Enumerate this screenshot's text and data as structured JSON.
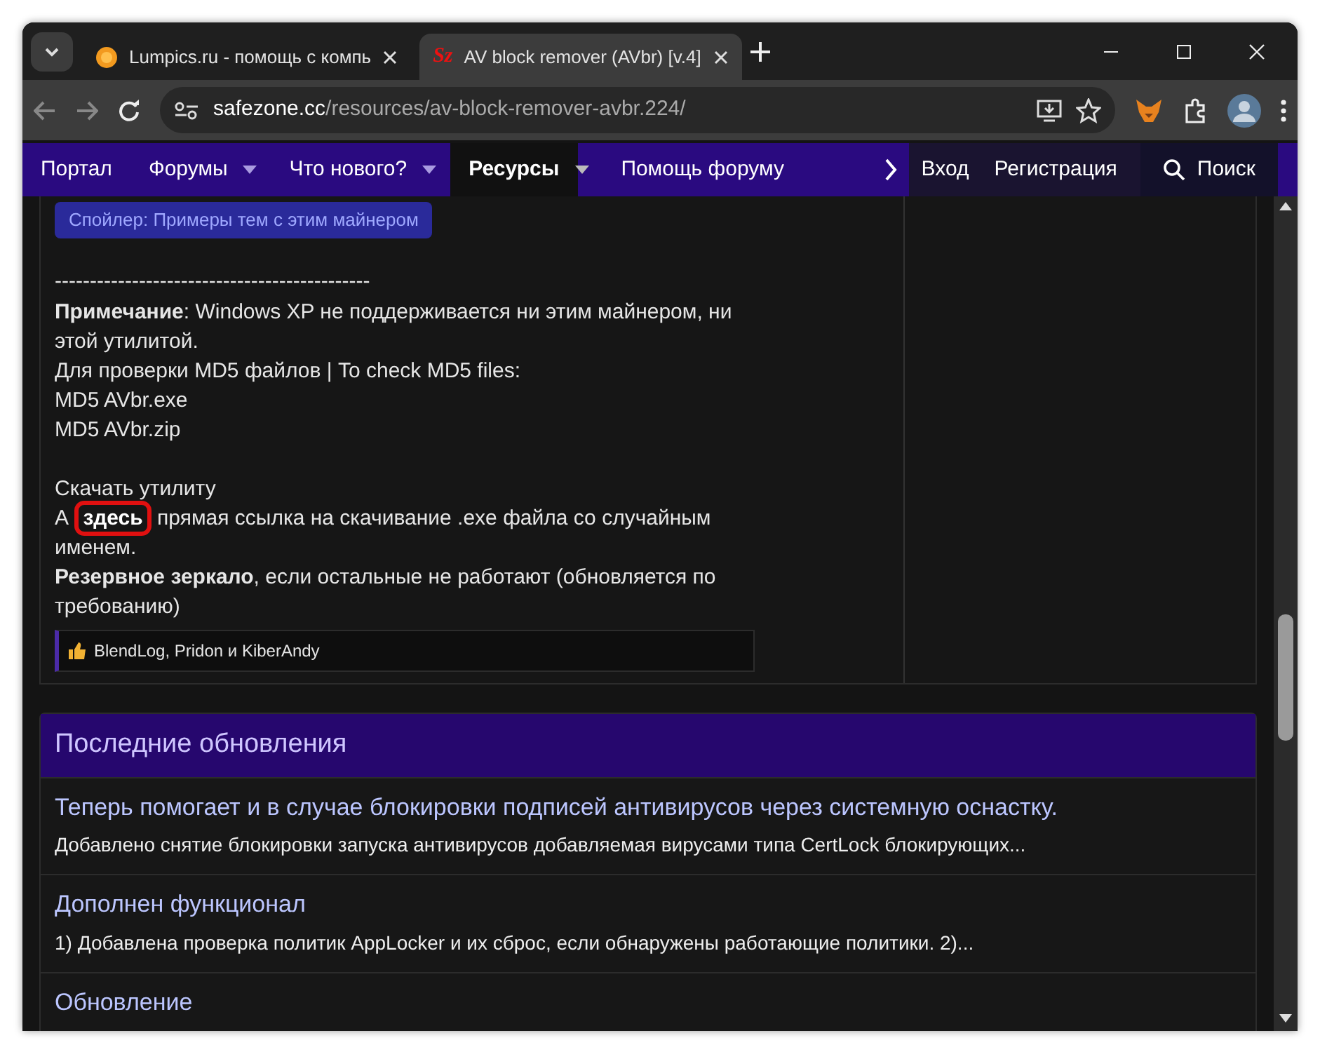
{
  "browser": {
    "tabs": [
      {
        "title": "Lumpics.ru - помощь с компь",
        "selected": false
      },
      {
        "title": "AV block remover (AVbr) [v.4]",
        "selected": true,
        "icon_text": "Sz"
      }
    ],
    "address": {
      "domain": "safezone.cc",
      "path": "/resources/av-block-remover-avbr.224/"
    }
  },
  "nav": {
    "items": [
      {
        "label": "Портал",
        "dropdown": false,
        "selected": false
      },
      {
        "label": "Форумы",
        "dropdown": true,
        "selected": false
      },
      {
        "label": "Что нового?",
        "dropdown": true,
        "selected": false
      },
      {
        "label": "Ресурсы",
        "dropdown": true,
        "selected": true
      },
      {
        "label": "Помощь форуму",
        "dropdown": false,
        "selected": false
      }
    ],
    "account": [
      "Вход",
      "Регистрация"
    ],
    "search": "Поиск"
  },
  "post": {
    "spoiler": "Спойлер: Примеры тем с этим майнером",
    "divider": "---------------------------------------------",
    "lines": [
      {
        "kind": "text",
        "text": "**Примечание**: Windows XP не поддерживается ни этим майнером, ни этой утилитой."
      },
      {
        "kind": "text",
        "text": "Для проверки MD5 файлов | To check MD5 files:"
      },
      {
        "kind": "text",
        "text": "MD5 AVbr.exe"
      },
      {
        "kind": "text",
        "text": "MD5 AVbr.zip"
      },
      {
        "kind": "blank"
      },
      {
        "kind": "text",
        "text": "Скачать утилиту"
      },
      {
        "kind": "link",
        "before": "А ",
        "link": "здесь",
        "after": " прямая ссылка на скачивание .exe файла со случайным именем.",
        "highlighted": true
      },
      {
        "kind": "text",
        "text": "**Резервное зеркало**, если остальные не работают (обновляется по требованию)"
      }
    ],
    "reactions": "BlendLog, Pridon и KiberAndy"
  },
  "updates": {
    "title": "Последние обновления",
    "items": [
      {
        "title": "Теперь помогает и в случае блокировки подписей антивирусов через системную оснастку.",
        "summary": "Добавлено снятие блокировки запуска антивирусов добавляемая вирусами типа CertLock блокирующих..."
      },
      {
        "title": "Дополнен функционал",
        "summary": "1) Добавлена проверка политик AppLocker и их сброс, если обнаружены работающие политики. 2)..."
      },
      {
        "title": "Обновление"
      }
    ]
  }
}
